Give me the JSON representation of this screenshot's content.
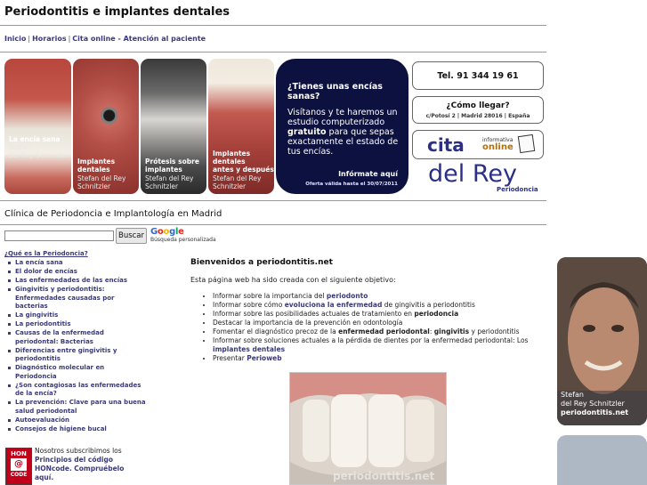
{
  "header": {
    "title": "Periodontitis e implantes dentales"
  },
  "nav": {
    "links": [
      "Inicio",
      "Horarios",
      "Cita online - Atención al paciente"
    ],
    "separator": "|"
  },
  "banner": {
    "photos": [
      {
        "caption": "La encía sana",
        "author": "Stefan\ndel Rey Schnitzler"
      },
      {
        "caption": "Implantes\ndentales",
        "author": "Stefan del Rey\nSchnitzler"
      },
      {
        "caption": "Prótesis sobre\nimplantes",
        "author": "Stefan del Rey\nSchnitzler"
      },
      {
        "caption": "Implantes\ndentales\nantes y después",
        "author": "Stefan del Rey\nSchnitzler"
      }
    ],
    "promo": {
      "question": "¿Tienes unas encías sanas?",
      "text_before": "Visítanos y te haremos un estudio computerizado ",
      "text_bold": "gratuito",
      "text_after": " para que sepas exactamente el estado de tus encías.",
      "cta": "Infórmate aquí",
      "validity": "Oferta válida hasta el 30/07/2011"
    },
    "phone": "Tel.  91 344 19 61",
    "how_to_get": {
      "title": "¿Cómo llegar?",
      "address": "c/Potosí 2 | Madrid 28016 | España"
    },
    "cita": {
      "word": "cita",
      "informativa": "informativa",
      "online": "online"
    },
    "brand": {
      "name": "del Rey",
      "subtitle": "Periodoncia"
    }
  },
  "clinic_heading": "Clínica de Periodoncia e Implantología en Madrid",
  "search": {
    "placeholder": "",
    "button_label": "Buscar",
    "logo_text": "Google",
    "note": "Búsqueda personalizada"
  },
  "sidebar": {
    "heading": "¿Qué es la Periodoncia?",
    "items": [
      "La encía sana",
      "El dolor de encías",
      "Las enfermedades de las encías",
      "Gingivitis y periodontitis: Enfermedades causadas por bacterias",
      "La gingivitis",
      "La periodontitis",
      "Causas de la enfermedad periodontal: Bacterias",
      "Diferencias entre gingivitis y periodontitis",
      "Diagnóstico molecular en Periodoncia",
      "¿Son contagiosas las enfermedades de la encía?",
      "La prevención: Clave para una buena salud periodontal",
      "Autoevaluación",
      "Consejos de higiene bucal"
    ]
  },
  "hon": {
    "logo_top": "HON",
    "logo_mid": "@",
    "logo_bottom": "CODE",
    "text_plain": "Nosotros subscribimos los ",
    "text_link": "Principios del código HONcode.",
    "verify_link": "Compruébelo aquí."
  },
  "main": {
    "welcome_title": "Bienvenidos a periodontitis.net",
    "intro": "Esta página web ha sido creada con el siguiente objetivo:",
    "objectives": [
      [
        {
          "t": "Informar sobre la importancia del "
        },
        {
          "t": "periodonto",
          "s": "link"
        }
      ],
      [
        {
          "t": "Informar sobre cómo "
        },
        {
          "t": "evoluciona la enfermedad",
          "s": "link"
        },
        {
          "t": " de gingivitis a periodontitis"
        }
      ],
      [
        {
          "t": "Informar sobre las posibilidades actuales de tratamiento en "
        },
        {
          "t": "periodoncia",
          "s": "bold"
        }
      ],
      [
        {
          "t": "Destacar la importancia de la prevención en odontología"
        }
      ],
      [
        {
          "t": "Fomentar el diagnóstico precoz de la "
        },
        {
          "t": "enfermedad periodontal",
          "s": "bold"
        },
        {
          "t": ": "
        },
        {
          "t": "gingivitis",
          "s": "bold"
        },
        {
          "t": " y periodontitis"
        }
      ],
      [
        {
          "t": "Informar sobre soluciones actuales a la pérdida de dientes por la enfermedad periodontal: Los "
        },
        {
          "t": "implantes dentales",
          "s": "link"
        }
      ],
      [
        {
          "t": "Presentar "
        },
        {
          "t": "Perioweb",
          "s": "link"
        }
      ]
    ],
    "photo_watermark": "periodontitis.net"
  },
  "portrait": {
    "name": "Stefan\ndel Rey Schnitzler",
    "site": "periodontitis.net"
  }
}
